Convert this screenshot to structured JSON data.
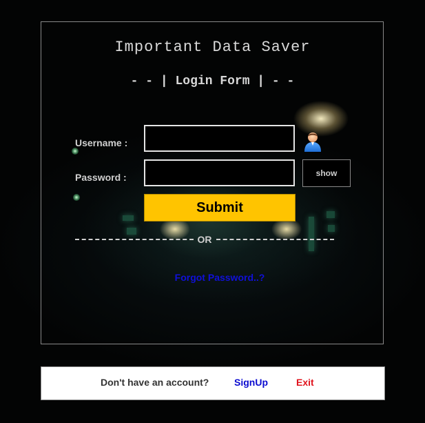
{
  "app": {
    "title": "Important Data Saver",
    "form_heading": "- - | Login Form | - -"
  },
  "login_form": {
    "username_label": "Username :",
    "username_value": "",
    "password_label": "Password :",
    "password_value": "",
    "user_icon": "user-avatar-icon",
    "show_label": "show",
    "submit_label": "Submit",
    "or_label": "OR",
    "forgot_label": "Forgot Password..?"
  },
  "signup_bar": {
    "prompt": "Don't have an account?",
    "signup_label": "SignUp",
    "exit_label": "Exit"
  },
  "colors": {
    "submit_background": "#ffc400",
    "link_blue": "#1010d8",
    "exit_red": "#e0141e",
    "page_background": "#030404"
  }
}
